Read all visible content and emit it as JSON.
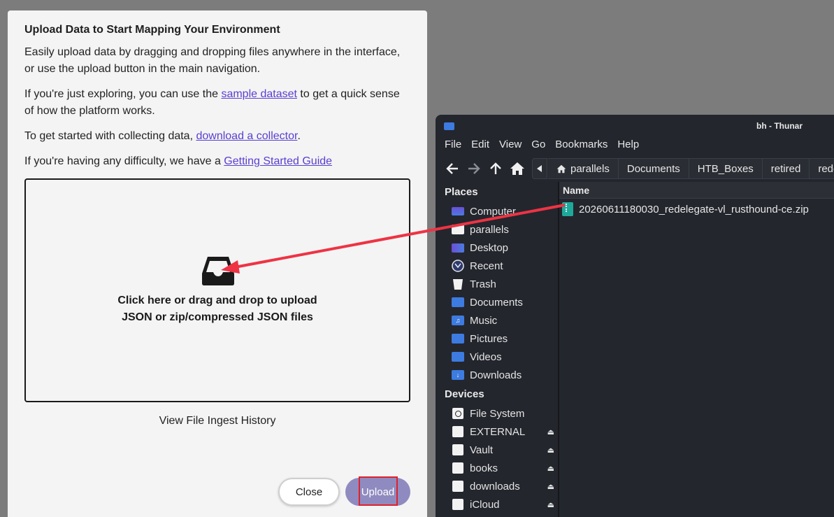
{
  "dialog": {
    "title": "Upload Data to Start Mapping Your Environment",
    "p1": "Easily upload data by dragging and dropping files anywhere in the interface, or use the upload button in the main navigation.",
    "p2_pre": "If you're just exploring, you can use the ",
    "p2_link": "sample dataset",
    "p2_post": " to get a quick sense of how the platform works.",
    "p3_pre": "To get started with collecting data, ",
    "p3_link": "download a collector",
    "p3_post": ".",
    "p4_pre": "If you're having any difficulty, we have a ",
    "p4_link": "Getting Started Guide",
    "dropzone_line1": "Click here or drag and drop to upload",
    "dropzone_line2": "JSON or zip/compressed JSON files",
    "history_link": "View File Ingest History",
    "close_label": "Close",
    "upload_label": "Upload"
  },
  "thunar": {
    "title": "bh - Thunar",
    "menu": [
      "File",
      "Edit",
      "View",
      "Go",
      "Bookmarks",
      "Help"
    ],
    "breadcrumbs": [
      "parallels",
      "Documents",
      "HTB_Boxes",
      "retired",
      "rede"
    ],
    "places_header": "Places",
    "places": [
      "Computer",
      "parallels",
      "Desktop",
      "Recent",
      "Trash",
      "Documents",
      "Music",
      "Pictures",
      "Videos",
      "Downloads"
    ],
    "devices_header": "Devices",
    "devices": [
      "File System",
      "EXTERNAL",
      "Vault",
      "books",
      "downloads",
      "iCloud"
    ],
    "column_name": "Name",
    "file_name": "20260611180030_redelegate-vl_rusthound-ce.zip"
  },
  "colors": {
    "accent_link": "#5a3fd0",
    "upload_button": "#8f8bc0",
    "highlight_red": "#e0202a",
    "thunar_bg": "#23262d",
    "zip_teal": "#1fa99b"
  }
}
